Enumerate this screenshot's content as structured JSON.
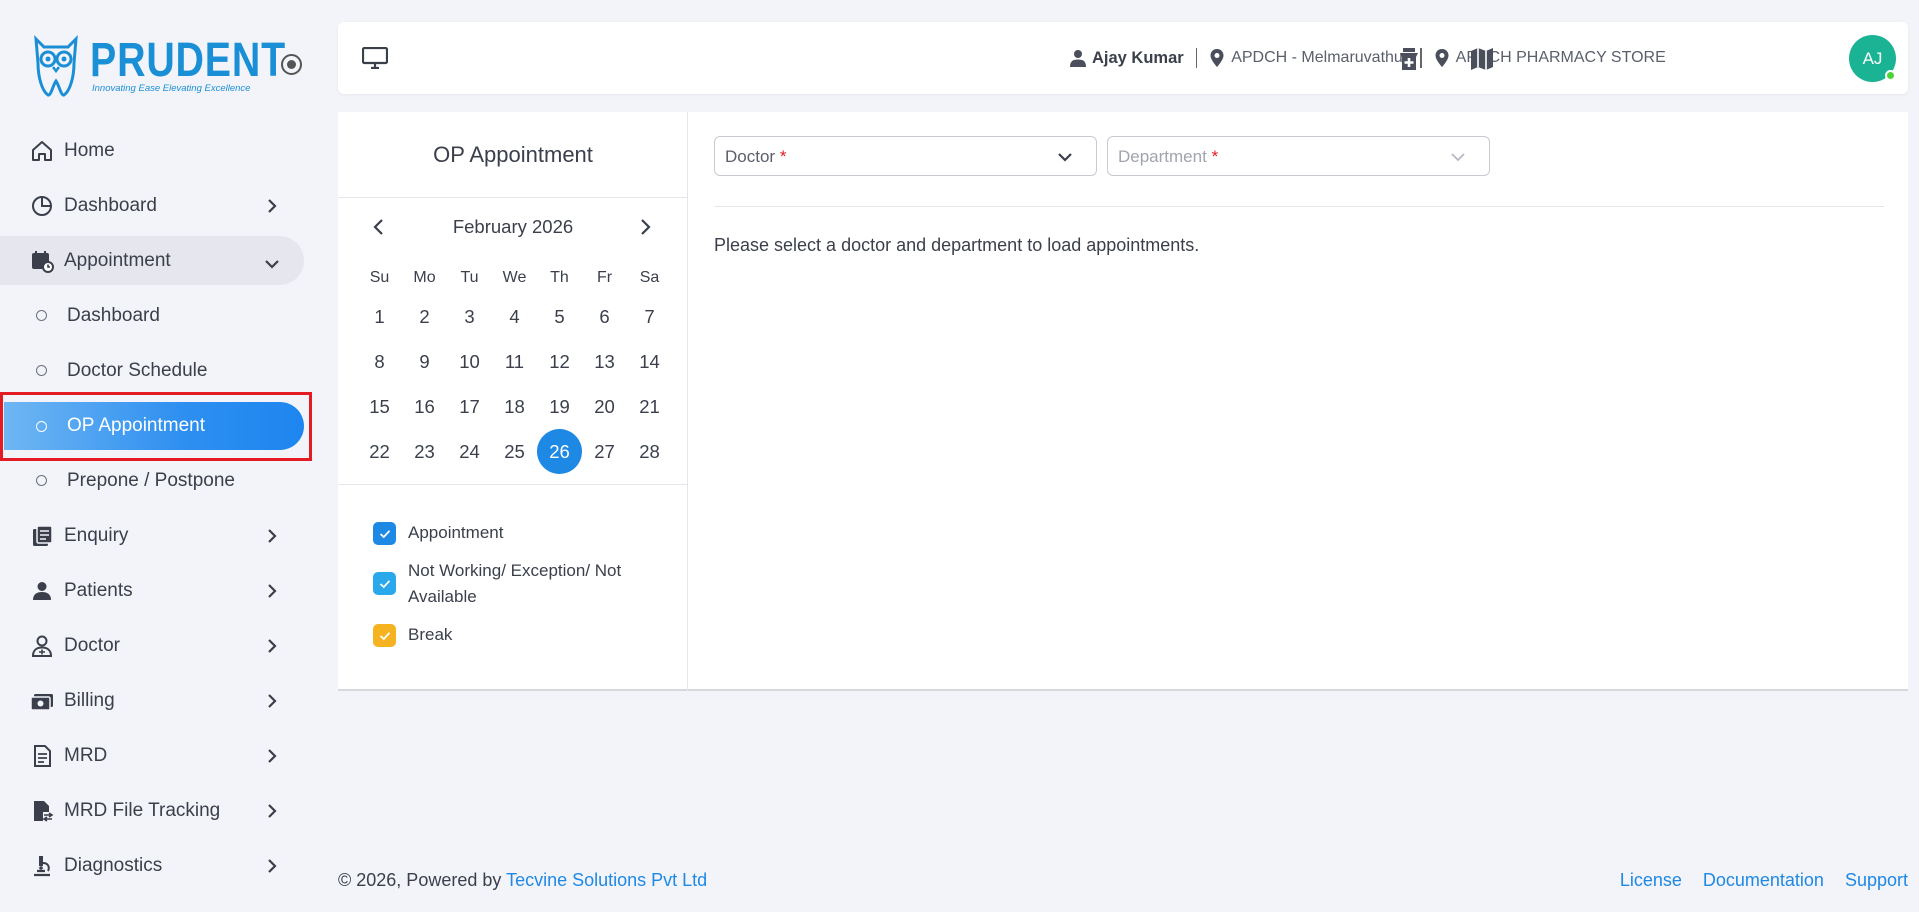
{
  "brand": {
    "name": "PRUDENT",
    "tagline": "Innovating Ease Elevating Excellence",
    "color": "#1b8fd6"
  },
  "sidebar": {
    "items": [
      {
        "label": "Home",
        "icon": "home-icon"
      },
      {
        "label": "Dashboard",
        "icon": "pie-chart-icon"
      },
      {
        "label": "Appointment",
        "icon": "calendar-clock-icon",
        "expanded": true
      },
      {
        "label": "Enquiry",
        "icon": "enquiry-icon"
      },
      {
        "label": "Patients",
        "icon": "person-icon"
      },
      {
        "label": "Doctor",
        "icon": "doctor-icon"
      },
      {
        "label": "Billing",
        "icon": "billing-icon"
      },
      {
        "label": "MRD",
        "icon": "document-icon"
      },
      {
        "label": "MRD File Tracking",
        "icon": "file-tracking-icon"
      },
      {
        "label": "Diagnostics",
        "icon": "microscope-icon"
      }
    ],
    "appointment_sub": [
      {
        "label": "Dashboard"
      },
      {
        "label": "Doctor Schedule"
      },
      {
        "label": "OP Appointment",
        "active": true
      },
      {
        "label": "Prepone / Postpone"
      }
    ],
    "active_color": "#1e86f0"
  },
  "header": {
    "user": "Ajay Kumar",
    "location": "APDCH - Melmaruvathur",
    "store": "APDCH PHARMACY STORE",
    "avatar_initials": "AJ",
    "avatar_color": "#1ab394"
  },
  "calendar_panel": {
    "title": "OP Appointment",
    "month_label": "February 2026",
    "weekdays": [
      "Su",
      "Mo",
      "Tu",
      "We",
      "Th",
      "Fr",
      "Sa"
    ],
    "weeks": [
      [
        "1",
        "2",
        "3",
        "4",
        "5",
        "6",
        "7"
      ],
      [
        "8",
        "9",
        "10",
        "11",
        "12",
        "13",
        "14"
      ],
      [
        "15",
        "16",
        "17",
        "18",
        "19",
        "20",
        "21"
      ],
      [
        "22",
        "23",
        "24",
        "25",
        "26",
        "27",
        "28"
      ]
    ],
    "selected_day": "26",
    "legend": [
      {
        "label": "Appointment",
        "color": "#1e88e5"
      },
      {
        "label": "Not Working/ Exception/ Not Available",
        "color": "#29a8ec"
      },
      {
        "label": "Break",
        "color": "#f5b321"
      }
    ]
  },
  "filters": {
    "doctor_label": "Doctor",
    "department_label": "Department",
    "required_mark": "*"
  },
  "main": {
    "empty_message": "Please select a doctor and department to load appointments."
  },
  "footer": {
    "copyright": "© 2026, Powered by",
    "company": "Tecvine Solutions Pvt Ltd",
    "links": [
      "License",
      "Documentation",
      "Support"
    ]
  }
}
